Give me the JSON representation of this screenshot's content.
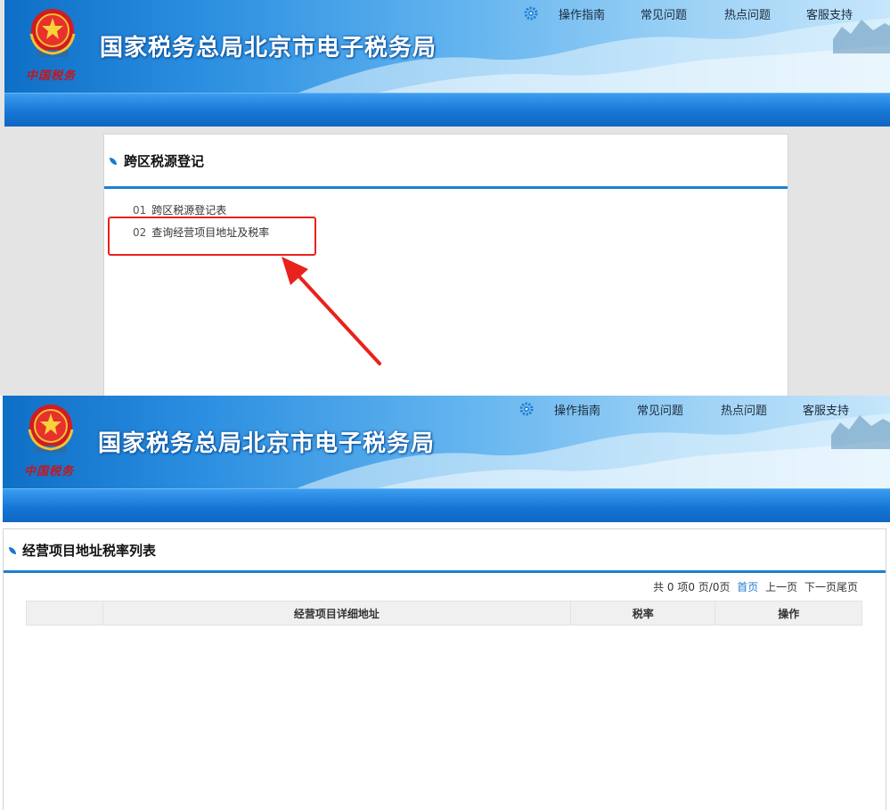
{
  "header": {
    "site_title": "国家税务总局北京市电子税务局",
    "emblem_caption": "中国税务",
    "links": [
      "操作指南",
      "常见问题",
      "热点问题",
      "客服支持"
    ],
    "icons": [
      "gear-icon",
      "emblem-icon"
    ]
  },
  "page1": {
    "panel_title": "跨区税源登记",
    "items": [
      {
        "num": "01",
        "label": "跨区税源登记表"
      },
      {
        "num": "02",
        "label": "查询经营项目地址及税率"
      }
    ],
    "annotation_color": "#e8221c"
  },
  "page2": {
    "panel_title": "经营项目地址税率列表",
    "pager": {
      "summary": "共 0 项0 页/0页",
      "first": "首页",
      "prev": "上一页",
      "next_last": "下一页尾页"
    },
    "table": {
      "columns": [
        "经营项目详细地址",
        "税率",
        "操作"
      ],
      "rows": []
    }
  },
  "colors": {
    "accent": "#1f7fd1",
    "banner": "#2b8ee0"
  }
}
